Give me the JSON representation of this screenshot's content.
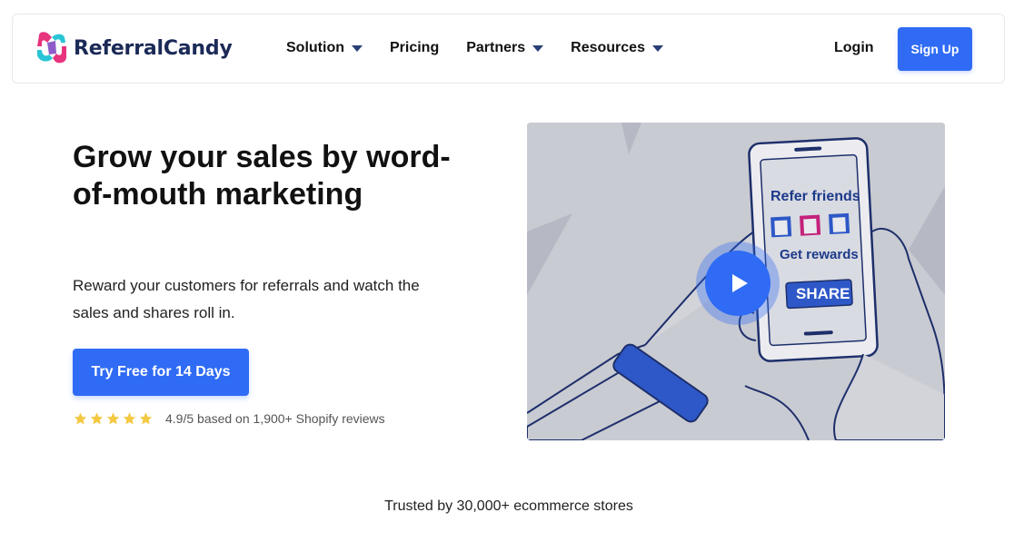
{
  "brand": {
    "name": "ReferralCandy"
  },
  "nav": {
    "items": [
      {
        "label": "Solution",
        "has_dropdown": true
      },
      {
        "label": "Pricing",
        "has_dropdown": false
      },
      {
        "label": "Partners",
        "has_dropdown": true
      },
      {
        "label": "Resources",
        "has_dropdown": true
      }
    ],
    "login_label": "Login",
    "signup_label": "Sign Up"
  },
  "hero": {
    "title": "Grow your sales by word-of-mouth marketing",
    "subtitle": "Reward your customers for referrals and watch the sales and shares roll in.",
    "cta_label": "Try Free for 14 Days",
    "rating": {
      "stars": 5,
      "text": "4.9/5 based on 1,900+ Shopify reviews"
    }
  },
  "video": {
    "refer_text": "Refer friends",
    "rewards_text": "Get rewards",
    "share_text": "SHARE",
    "play_icon": "play-icon"
  },
  "trusted_text": "Trusted by 30,000+ ecommerce stores",
  "colors": {
    "primary": "#2f6bf4",
    "brand_dark": "#1b2a57",
    "star": "#f5c842",
    "video_bg": "#c9cbd2"
  }
}
